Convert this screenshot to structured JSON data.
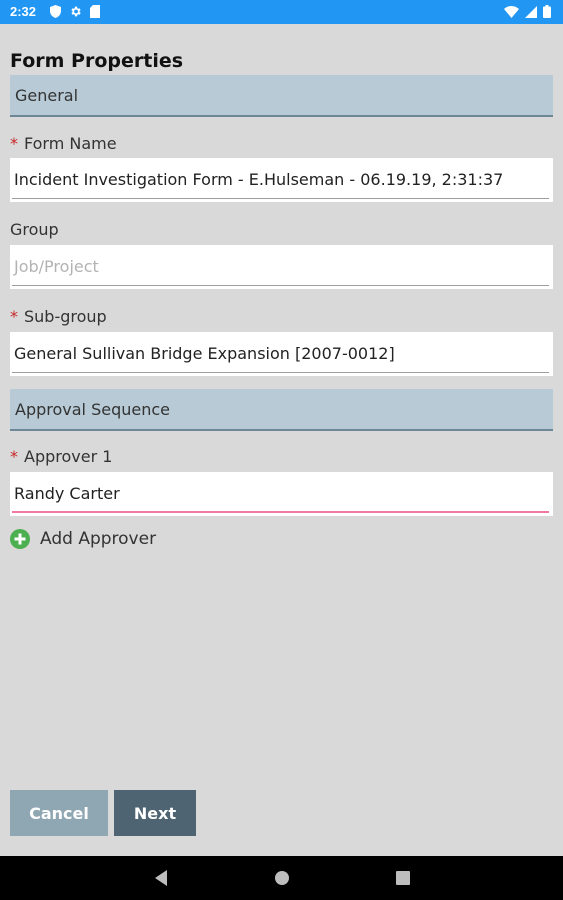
{
  "status_bar": {
    "time": "2:32",
    "left_icons": [
      "shield-icon",
      "gear-icon",
      "sd-card-icon"
    ],
    "right_icons": [
      "wifi-icon",
      "signal-icon",
      "battery-icon"
    ],
    "color": "#2196f3"
  },
  "page": {
    "title": "Form Properties"
  },
  "sections": {
    "general": "General",
    "approval": "Approval Sequence"
  },
  "fields": {
    "form_name": {
      "label": "Form Name",
      "required_marker": "*",
      "value": "Incident Investigation Form - E.Hulseman - 06.19.19, 2:31:37"
    },
    "group": {
      "label": "Group",
      "placeholder": "Job/Project"
    },
    "sub_group": {
      "label": "Sub-group",
      "required_marker": "*",
      "value": "General Sullivan Bridge Expansion [2007-0012]"
    },
    "approver_1": {
      "label": "Approver 1",
      "required_marker": "*",
      "value": "Randy Carter"
    }
  },
  "add_approver": {
    "label": "Add Approver",
    "icon": "add-circle-icon",
    "icon_color": "#4caf50"
  },
  "buttons": {
    "cancel": "Cancel",
    "next": "Next"
  },
  "colors": {
    "section_bg": "#b7cad6",
    "cancel_bg": "#8fa6b3",
    "next_bg": "#4e6472",
    "required": "#c62828",
    "active_underline": "#f06292"
  }
}
